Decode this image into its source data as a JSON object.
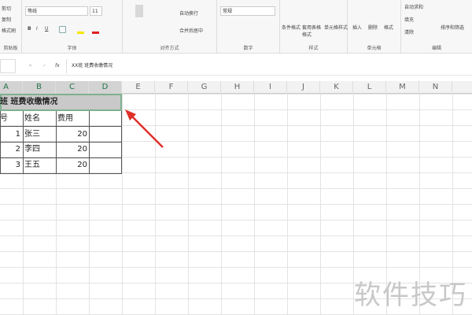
{
  "ribbon": {
    "clipboard": {
      "cut": "剪切",
      "copy": "复制",
      "painter": "格式刷",
      "label": "剪贴板"
    },
    "font": {
      "name": "等线",
      "size": "11",
      "bold": "B",
      "italic": "I",
      "underline": "U",
      "label": "字体"
    },
    "align": {
      "wrap": "自动换行",
      "merge": "合并后居中",
      "label": "对齐方式"
    },
    "number": {
      "format": "常规",
      "label": "数字"
    },
    "styles": {
      "conditional": "条件格式",
      "table": "套用表格格式",
      "cell": "单元格样式",
      "label": "样式"
    },
    "cells": {
      "insert": "插入",
      "delete": "删除",
      "format": "格式",
      "label": "单元格"
    },
    "editing": {
      "autosum": "自动求和",
      "fill": "填充",
      "clear": "清除",
      "sort": "排序和筛选",
      "label": "编辑"
    }
  },
  "formula_bar": {
    "cancel": "✕",
    "enter": "✓",
    "fx": "fx",
    "value": "XX班 班费收缴情况"
  },
  "columns": [
    "A",
    "B",
    "C",
    "D",
    "E",
    "F",
    "G",
    "H",
    "I",
    "J",
    "K",
    "L",
    "M",
    "N"
  ],
  "sheet": {
    "title": "班 班费收缴情况",
    "headers": [
      "号",
      "姓名",
      "费用"
    ],
    "rows": [
      [
        "1",
        "张三",
        "20"
      ],
      [
        "2",
        "李四",
        "20"
      ],
      [
        "3",
        "王五",
        "20"
      ]
    ]
  },
  "watermark": "软件技巧",
  "colors": {
    "arrow": "#e0302a",
    "selection": "#217346"
  }
}
